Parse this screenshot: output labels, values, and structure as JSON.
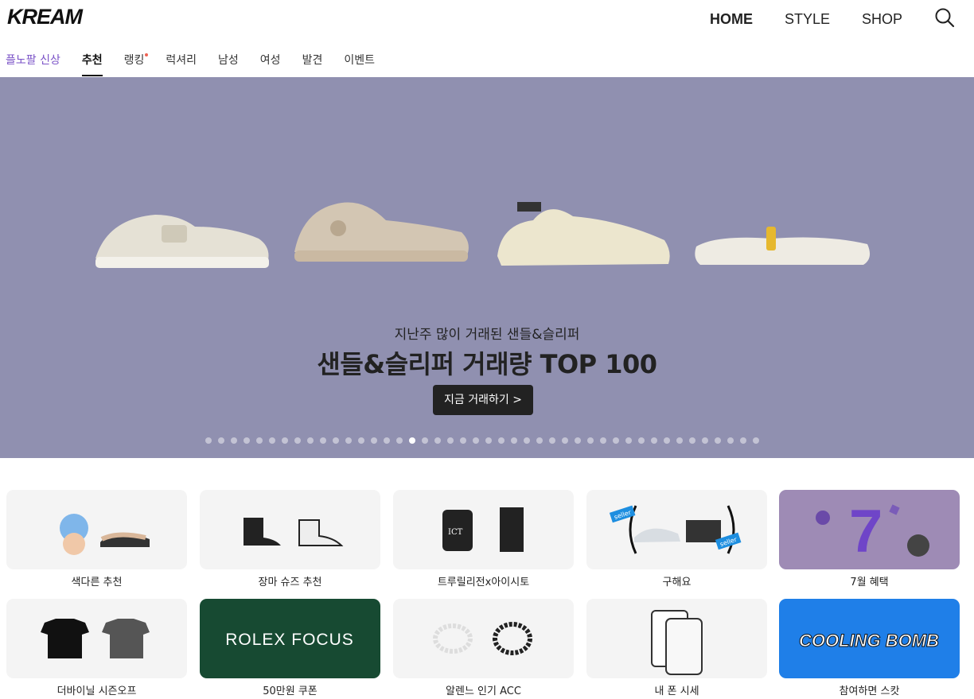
{
  "header": {
    "logo": "KREAM",
    "nav": [
      "HOME",
      "STYLE",
      "SHOP"
    ],
    "search_icon": "search-icon"
  },
  "tabs": [
    {
      "label": "플노팔 신상"
    },
    {
      "label": "추천"
    },
    {
      "label": "랭킹"
    },
    {
      "label": "럭셔리"
    },
    {
      "label": "남성"
    },
    {
      "label": "여성"
    },
    {
      "label": "발견"
    },
    {
      "label": "이벤트"
    }
  ],
  "banner": {
    "subtitle": "지난주 많이 거래된 샌들&슬리퍼",
    "title": "샌들&슬리퍼 거래량 TOP 100",
    "button": "지금 거래하기 >",
    "slide_count": 44,
    "active_slide": 16,
    "bg_color": "#9090b0"
  },
  "shortcuts": [
    {
      "label": "색다른 추천"
    },
    {
      "label": "장마 슈즈 추천"
    },
    {
      "label": "트루릴리전x아이시토",
      "thumb_text": "ICT"
    },
    {
      "label": "구해요",
      "thumb_badges": [
        "seller",
        "seller"
      ]
    },
    {
      "label": "7월 혜택",
      "thumb_text": "7"
    },
    {
      "label": "더바이닐 시즌오프"
    },
    {
      "label": "50만원 쿠폰",
      "thumb_text": "ROLEX FOCUS"
    },
    {
      "label": "알렌느 인기 ACC"
    },
    {
      "label": "내 폰 시세"
    },
    {
      "label": "참여하면 스캇",
      "thumb_text": "COOLING BOMB"
    }
  ]
}
